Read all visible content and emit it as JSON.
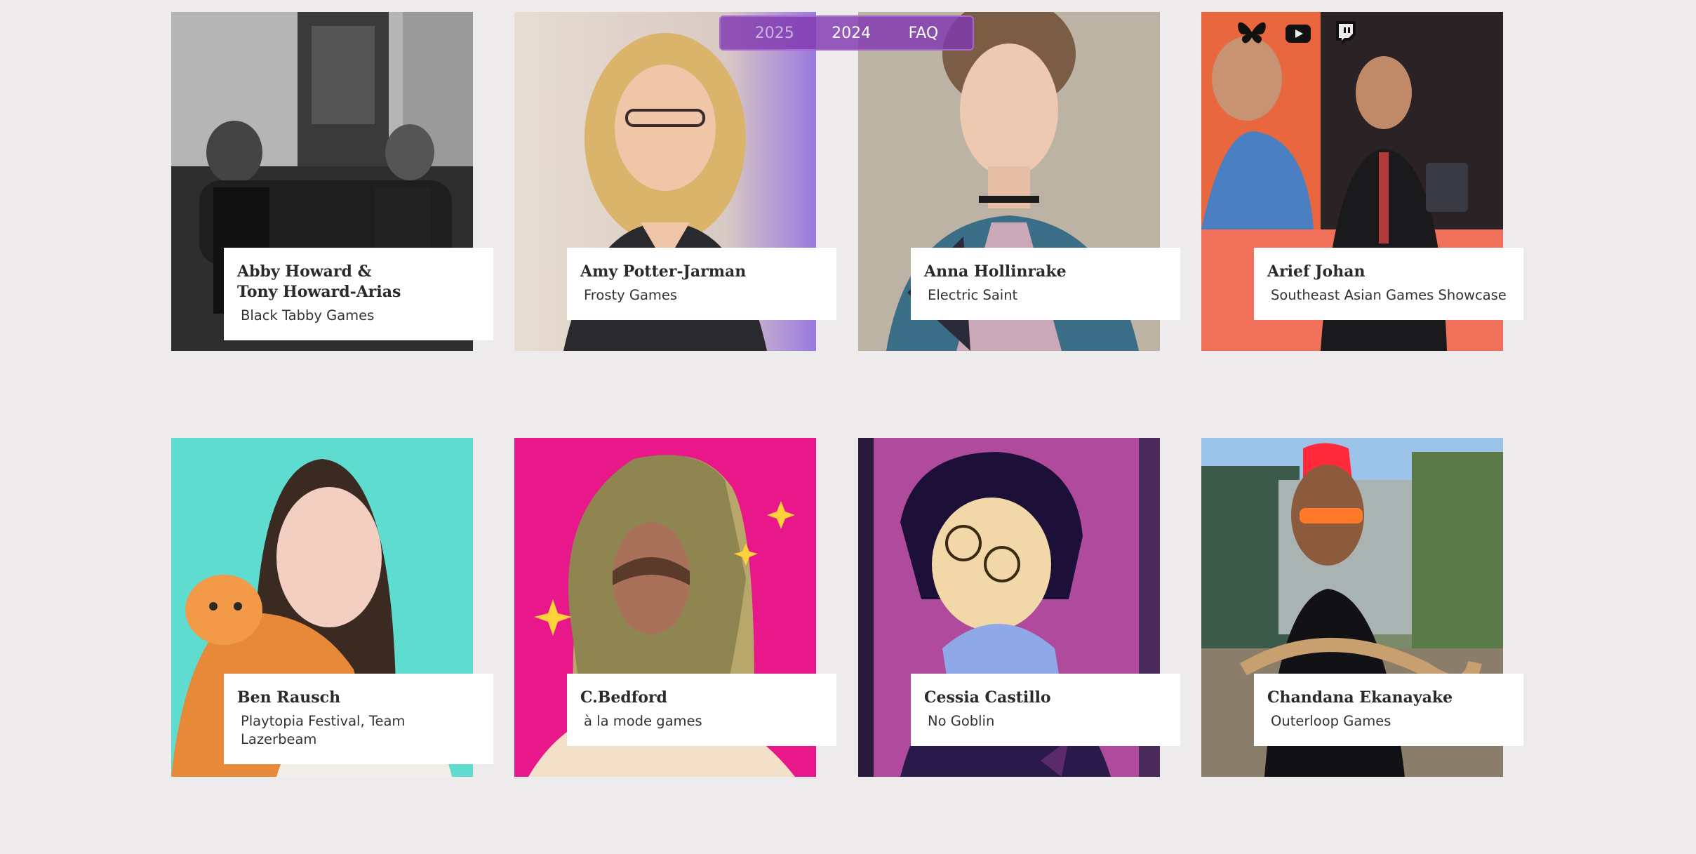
{
  "nav": {
    "items": [
      "2025",
      "2024",
      "FAQ"
    ]
  },
  "social": {
    "icons": [
      "bluesky-icon",
      "youtube-icon",
      "twitch-icon"
    ]
  },
  "speakers": [
    {
      "name": "Abby Howard &\nTony Howard-Arias",
      "company": "Black Tabby Games"
    },
    {
      "name": "Amy Potter-Jarman",
      "company": "Frosty Games"
    },
    {
      "name": "Anna Hollinrake",
      "company": "Electric Saint"
    },
    {
      "name": "Arief Johan",
      "company": "Southeast Asian Games Showcase"
    },
    {
      "name": "Ben Rausch",
      "company": "Playtopia Festival, Team Lazerbeam"
    },
    {
      "name": "C.Bedford",
      "company": "à la mode games"
    },
    {
      "name": "Cessia Castillo",
      "company": "No Goblin"
    },
    {
      "name": "Chandana Ekanayake",
      "company": "Outerloop Games"
    }
  ],
  "colors": {
    "page_background": "#edebec",
    "nav_background": "#8038b0",
    "caption_background": "#ffffff"
  }
}
